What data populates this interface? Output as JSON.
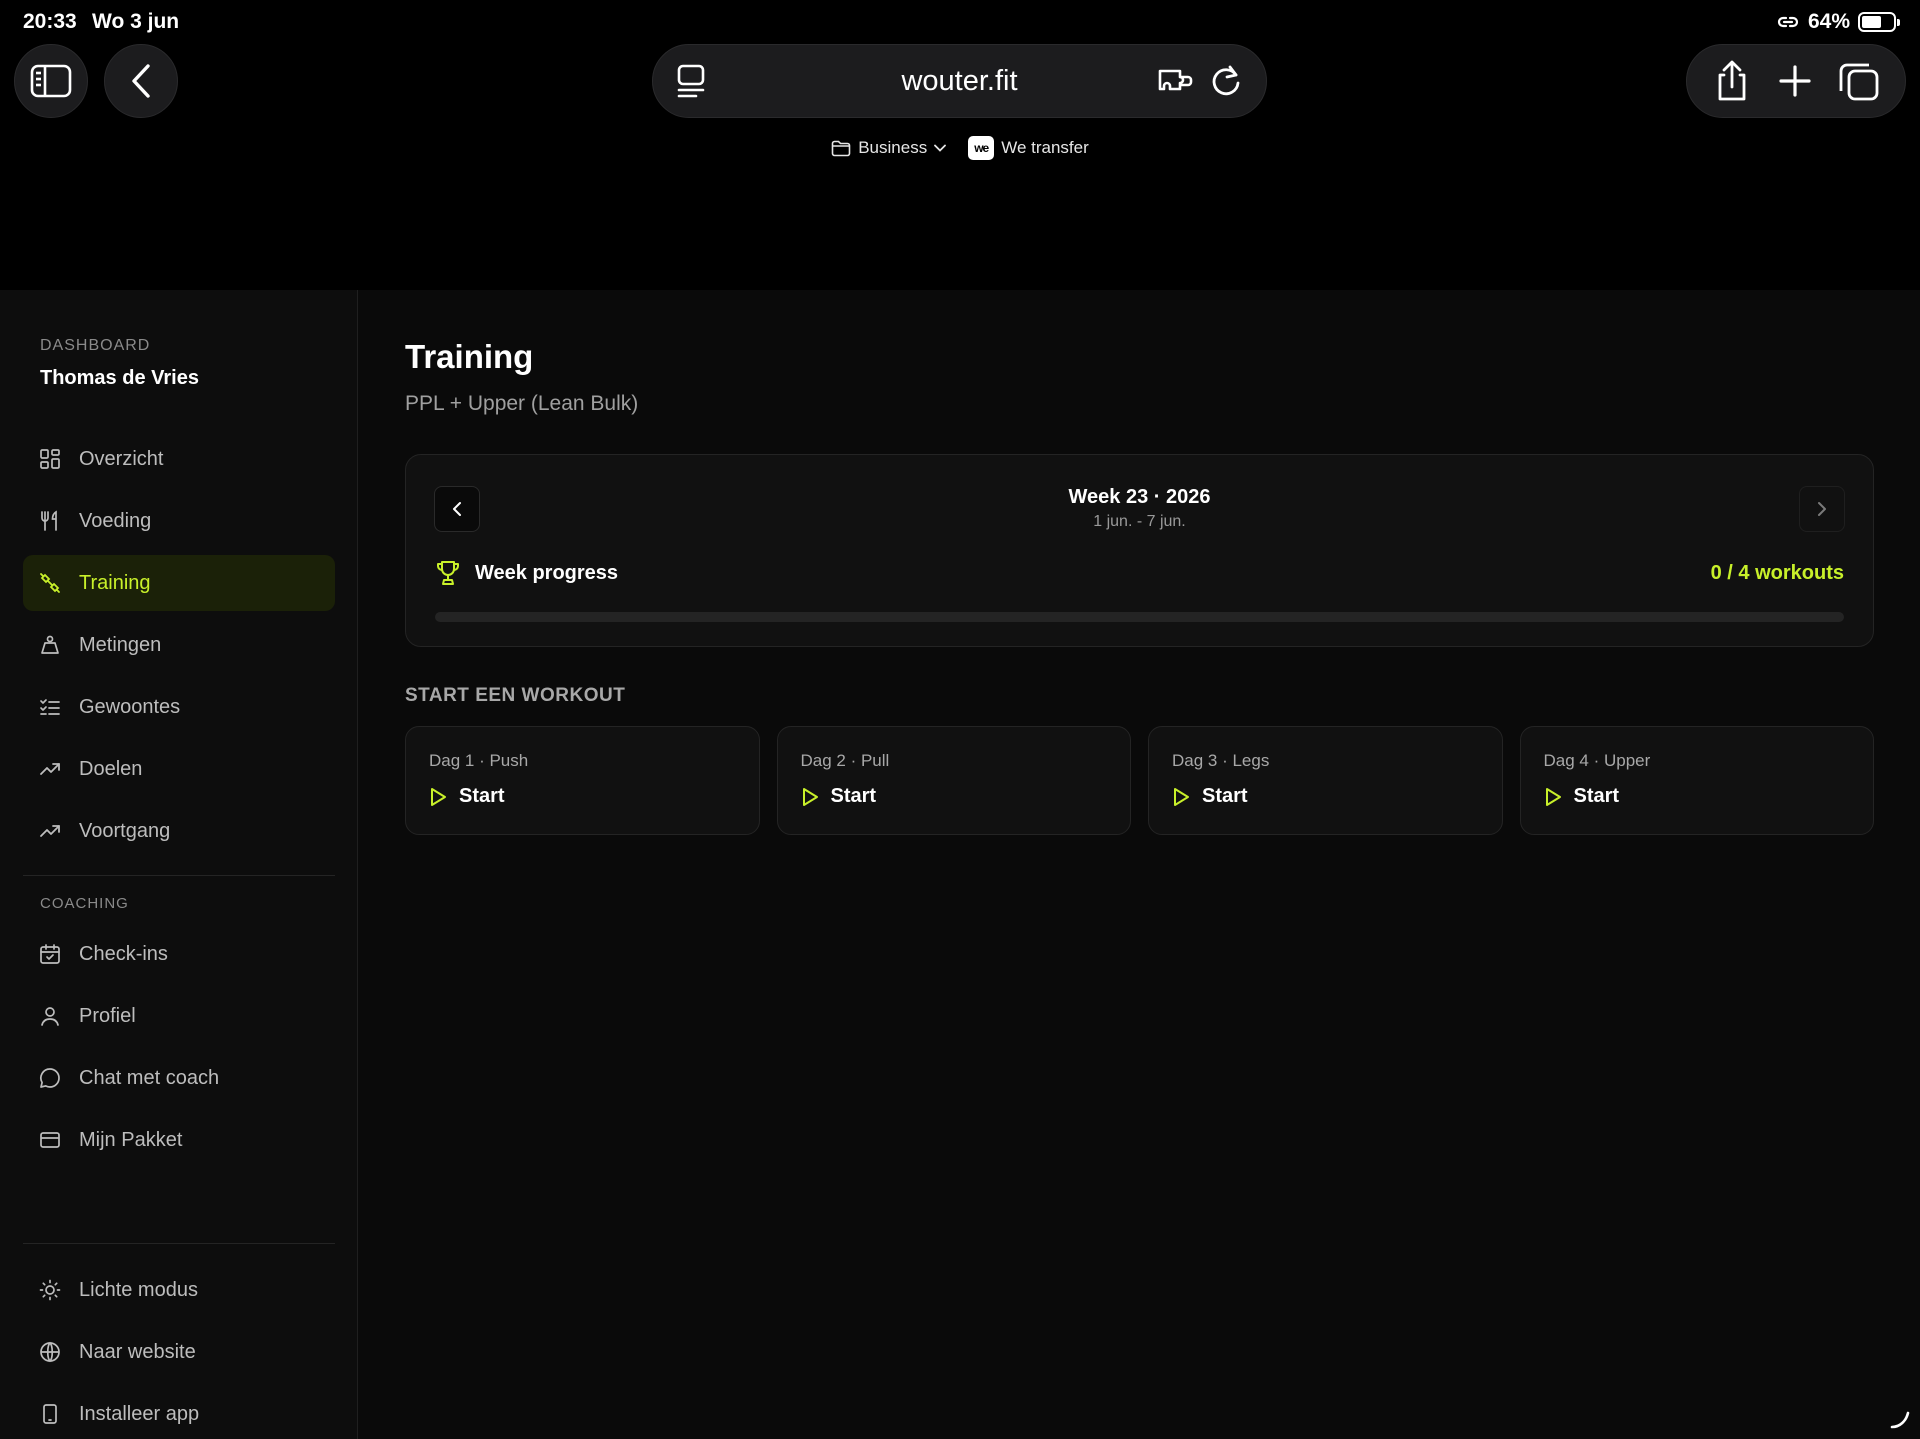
{
  "status_bar": {
    "time": "20:33",
    "date": "Wo 3 jun",
    "battery": "64%",
    "battery_level": 0.64
  },
  "browser": {
    "url": "wouter.fit",
    "bookmarks": [
      {
        "label": "Business",
        "icon": "folder-icon"
      },
      {
        "label": "We transfer",
        "icon": "wetransfer-icon",
        "badge": "we"
      }
    ]
  },
  "sidebar": {
    "section_dashboard": "DASHBOARD",
    "user_name": "Thomas de Vries",
    "items": [
      {
        "label": "Overzicht",
        "icon": "grid-icon"
      },
      {
        "label": "Voeding",
        "icon": "utensils-icon"
      },
      {
        "label": "Training",
        "icon": "dumbbell-icon",
        "active": true
      },
      {
        "label": "Metingen",
        "icon": "weight-icon"
      },
      {
        "label": "Gewoontes",
        "icon": "checklist-icon"
      },
      {
        "label": "Doelen",
        "icon": "trend-up-icon"
      },
      {
        "label": "Voortgang",
        "icon": "trend-up-icon"
      }
    ],
    "section_coaching": "COACHING",
    "coaching_items": [
      {
        "label": "Check-ins",
        "icon": "calendar-check-icon"
      },
      {
        "label": "Profiel",
        "icon": "user-icon"
      },
      {
        "label": "Chat met coach",
        "icon": "chat-icon"
      },
      {
        "label": "Mijn Pakket",
        "icon": "card-icon"
      }
    ],
    "footer_items": [
      {
        "label": "Lichte modus",
        "icon": "sun-icon"
      },
      {
        "label": "Naar website",
        "icon": "globe-icon"
      },
      {
        "label": "Installeer app",
        "icon": "phone-icon"
      }
    ]
  },
  "main": {
    "title": "Training",
    "subtitle": "PPL + Upper (Lean Bulk)",
    "week": {
      "label": "Week 23 · 2026",
      "range": "1 jun. - 7 jun.",
      "progress_label": "Week progress",
      "progress_count": "0 / 4 workouts",
      "progress_fraction": 0
    },
    "section_title": "START EEN WORKOUT",
    "workouts": [
      {
        "label": "Dag 1 · Push",
        "action": "Start"
      },
      {
        "label": "Dag 2 · Pull",
        "action": "Start"
      },
      {
        "label": "Dag 3 · Legs",
        "action": "Start"
      },
      {
        "label": "Dag 4 · Upper",
        "action": "Start"
      }
    ]
  },
  "colors": {
    "accent": "#c8f02a",
    "background": "#0a0a0a",
    "card": "#111111",
    "border": "#242424"
  }
}
